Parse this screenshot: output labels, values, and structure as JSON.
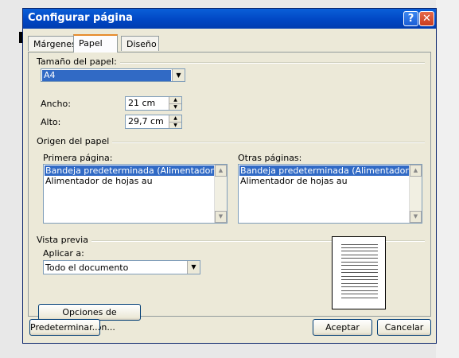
{
  "dialog": {
    "title": "Configurar página"
  },
  "tabs": [
    {
      "label": "Márgenes"
    },
    {
      "label": "Papel"
    },
    {
      "label": "Diseño"
    }
  ],
  "paper_size": {
    "group_label": "Tamaño del papel:",
    "selected": "A4",
    "width_label": "Ancho:",
    "width_value": "21 cm",
    "height_label": "Alto:",
    "height_value": "29,7 cm"
  },
  "paper_source": {
    "group_label": "Origen del papel",
    "first_page_label": "Primera página:",
    "other_pages_label": "Otras páginas:",
    "first_page_items": [
      "Bandeja predeterminada (Alimentador de hojas",
      "Alimentador de hojas au"
    ],
    "other_pages_items": [
      "Bandeja predeterminada (Alimentador de hojas",
      "Alimentador de hojas au"
    ]
  },
  "preview": {
    "group_label": "Vista previa",
    "apply_label": "Aplicar a:",
    "apply_value": "Todo el documento"
  },
  "buttons": {
    "print_options": "Opciones de impresión...",
    "default": "Predeterminar...",
    "ok": "Aceptar",
    "cancel": "Cancelar",
    "help": "?",
    "close": "✕"
  }
}
